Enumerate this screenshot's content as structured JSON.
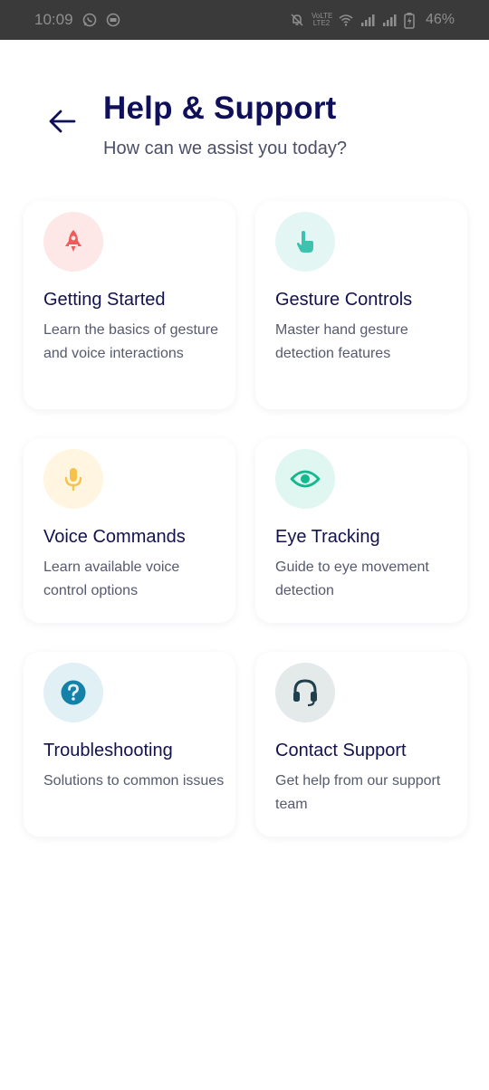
{
  "status_bar": {
    "time": "10:09",
    "battery": "46%",
    "network_label": "VoLTE LTE2"
  },
  "header": {
    "title": "Help & Support",
    "subtitle": "How can we assist you today?"
  },
  "cards": [
    {
      "title": "Getting Started",
      "description": "Learn the basics of gesture and voice interactions",
      "icon": "rocket-icon",
      "icon_bg": "#fde7e7",
      "icon_color": "#ef5b5b"
    },
    {
      "title": "Gesture Controls",
      "description": "Master hand gesture detection features",
      "icon": "tap-hand-icon",
      "icon_bg": "#e3f6f4",
      "icon_color": "#3cc3b0"
    },
    {
      "title": "Voice Commands",
      "description": "Learn available voice control options",
      "icon": "microphone-icon",
      "icon_bg": "#fff5e0",
      "icon_color": "#f5c34a"
    },
    {
      "title": "Eye Tracking",
      "description": "Guide to eye movement detection",
      "icon": "eye-icon",
      "icon_bg": "#e0f6f0",
      "icon_color": "#14b88f"
    },
    {
      "title": "Troubleshooting",
      "description": "Solutions to common issues",
      "icon": "help-circle-icon",
      "icon_bg": "#e1f0f5",
      "icon_color": "#1381a8"
    },
    {
      "title": "Contact Support",
      "description": "Get help from our support team",
      "icon": "headset-icon",
      "icon_bg": "#e4e9ea",
      "icon_color": "#1f3f4c"
    }
  ]
}
